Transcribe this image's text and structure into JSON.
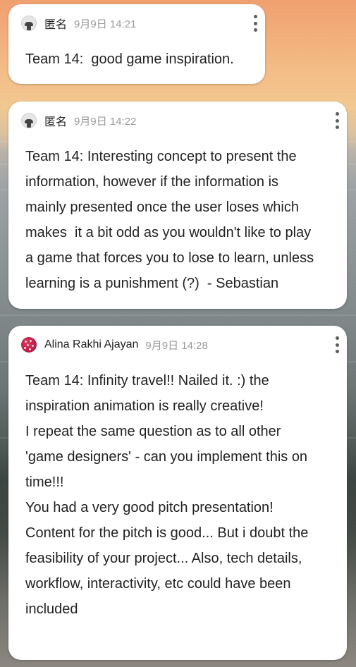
{
  "posts": [
    {
      "author": "匿名",
      "time": "9月9日 14:21",
      "avatar": "anonymous-avatar",
      "text": "Team 14:  good game inspiration."
    },
    {
      "author": "匿名",
      "time": "9月9日 14:22",
      "avatar": "anonymous-avatar",
      "text": "Team 14: Interesting concept to present the\ninformation, however if the information is\nmainly presented once the user loses which\nmakes  it a bit odd as you wouldn't like to play\na game that forces you to lose to learn, unless\nlearning is a punishment (?)  - Sebastian"
    },
    {
      "author": "Alina Rakhi Ajayan",
      "time": "9月9日 14:28",
      "avatar": "user-avatar",
      "text": "Team 14: Infinity travel!! Nailed it. :) the\ninspiration animation is really creative!\nI repeat the same question as to all other\n'game designers' - can you implement this on\ntime!!!\nYou had a very good pitch presentation!\nContent for the pitch is good... But i doubt the\nfeasibility of your project... Also, tech details,\nworkflow, interactivity, etc could have been\nincluded"
    }
  ],
  "icons": {
    "menu": "more-vertical-icon",
    "anonymous": "anonymous-avatar",
    "user": "user-avatar"
  },
  "colors": {
    "card_background": "#ffffff",
    "text": "#222222",
    "timestamp": "#9a9a9a",
    "menu_dots": "#5e5e5e"
  }
}
